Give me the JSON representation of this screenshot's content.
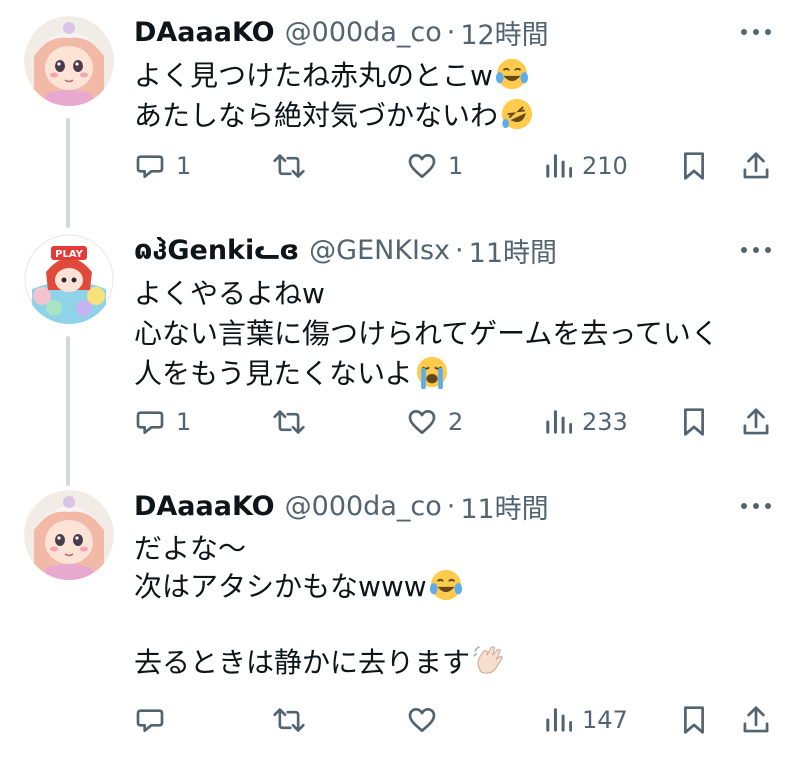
{
  "tweets": [
    {
      "display_name": "DAaaaKO",
      "handle": "@000da_co",
      "separator": "·",
      "time": "12時間",
      "lines": [
        "よく見つけたね赤丸のとこw",
        "あたしなら絶対気づかないわ"
      ],
      "line_emojis": [
        "tears-of-joy-emoji",
        "rolling-on-floor-laughing-emoji"
      ],
      "replies": "1",
      "retweets": "",
      "likes": "1",
      "views": "210"
    },
    {
      "display_name": "ɷჰGenkiᓚɞ",
      "handle": "@GENKIsx",
      "separator": "·",
      "time": "11時間",
      "lines": [
        "よくやるよねw",
        "心ない言葉に傷つけられてゲームを去っていく",
        "人をもう見たくないよ"
      ],
      "line_emojis": [
        "",
        "",
        "loudly-crying-emoji"
      ],
      "avatar_badge": "PLAY",
      "replies": "1",
      "retweets": "",
      "likes": "2",
      "views": "233"
    },
    {
      "display_name": "DAaaaKO",
      "handle": "@000da_co",
      "separator": "·",
      "time": "11時間",
      "lines": [
        "だよな〜",
        "次はアタシかもなwww",
        "",
        "去るときは静かに去ります"
      ],
      "line_emojis": [
        "",
        "tears-of-joy-emoji",
        "",
        "waving-hand-emoji"
      ],
      "replies": "",
      "retweets": "",
      "likes": "",
      "views": "147"
    }
  ],
  "icons": {
    "reply": "reply-icon",
    "retweet": "retweet-icon",
    "like": "like-icon",
    "views": "views-icon",
    "bookmark": "bookmark-icon",
    "share": "share-icon",
    "more": "more-icon"
  },
  "colors": {
    "text": "#0f1419",
    "secondary": "#536471",
    "thread_line": "#cfd9de"
  }
}
